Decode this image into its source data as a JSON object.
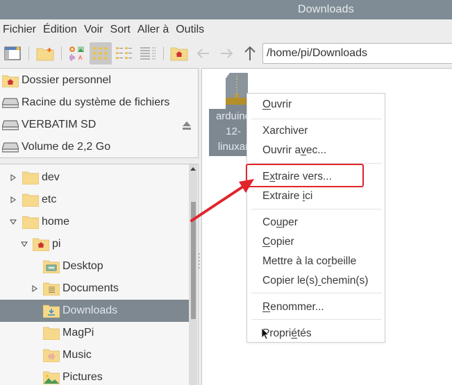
{
  "window": {
    "title": "Downloads"
  },
  "menubar": {
    "items": [
      "Fichier",
      "Édition",
      "Voir",
      "Sort",
      "Aller à",
      "Outils"
    ]
  },
  "toolbar": {
    "buttons": [
      {
        "icon": "new-window-icon"
      },
      {
        "icon": "new-folder-icon"
      },
      {
        "icon": "thumbnail-view-icon"
      },
      {
        "icon": "icon-view-icon",
        "active": true
      },
      {
        "icon": "compact-view-icon"
      },
      {
        "icon": "detailed-list-view-icon"
      },
      {
        "icon": "home-folder-icon"
      },
      {
        "icon": "back-arrow-icon",
        "enabled": false
      },
      {
        "icon": "forward-arrow-icon",
        "enabled": false
      },
      {
        "icon": "up-arrow-icon",
        "enabled": true
      }
    ],
    "path": "/home/pi/Downloads"
  },
  "places": [
    {
      "label": "Dossier personnel",
      "icon": "home-folder-icon"
    },
    {
      "label": "Racine du système de fichiers",
      "icon": "drive-icon"
    },
    {
      "label": "VERBATIM SD",
      "icon": "drive-icon",
      "eject": true
    },
    {
      "label": "Volume de 2,2 Go",
      "icon": "drive-icon"
    }
  ],
  "tree": [
    {
      "label": "dev",
      "depth": 0,
      "expander": "collapsed",
      "icon": "folder-icon"
    },
    {
      "label": "etc",
      "depth": 0,
      "expander": "collapsed",
      "icon": "folder-icon"
    },
    {
      "label": "home",
      "depth": 0,
      "expander": "expanded",
      "icon": "folder-icon"
    },
    {
      "label": "pi",
      "depth": 1,
      "expander": "expanded",
      "icon": "home-folder-icon"
    },
    {
      "label": "Desktop",
      "depth": 2,
      "expander": "none",
      "icon": "desktop-folder-icon"
    },
    {
      "label": "Documents",
      "depth": 2,
      "expander": "collapsed",
      "icon": "documents-folder-icon"
    },
    {
      "label": "Downloads",
      "depth": 2,
      "expander": "none",
      "icon": "downloads-folder-icon",
      "selected": true
    },
    {
      "label": "MagPi",
      "depth": 2,
      "expander": "none",
      "icon": "folder-icon"
    },
    {
      "label": "Music",
      "depth": 2,
      "expander": "none",
      "icon": "music-folder-icon"
    },
    {
      "label": "Pictures",
      "depth": 2,
      "expander": "none",
      "icon": "pictures-folder-icon"
    }
  ],
  "files": [
    {
      "name_lines": [
        "arduino",
        "12-",
        "linuxar"
      ],
      "icon": "archive-icon",
      "selected": true
    }
  ],
  "context_menu": {
    "items": [
      {
        "label": "Ouvrir",
        "mnemonic_index": 0
      },
      {
        "separator": true
      },
      {
        "label": "Xarchiver",
        "mnemonic_index": -1
      },
      {
        "label": "Ouvrir avec...",
        "mnemonic_index": 8
      },
      {
        "separator": true
      },
      {
        "label": "Extraire vers...",
        "mnemonic_index": 1,
        "highlighted": true
      },
      {
        "label": "Extraire ici",
        "mnemonic_index": 9
      },
      {
        "separator": true
      },
      {
        "label": "Couper",
        "mnemonic_index": 2
      },
      {
        "label": "Copier",
        "mnemonic_index": 0
      },
      {
        "label": "Mettre à la corbeille",
        "mnemonic_index": 14
      },
      {
        "label": "Copier le(s) chemin(s)",
        "mnemonic_index": 12
      },
      {
        "separator": true
      },
      {
        "label": "Renommer...",
        "mnemonic_index": 0
      },
      {
        "separator": true
      },
      {
        "label": "Propriétés",
        "mnemonic_index": 6
      }
    ]
  },
  "annotation": {
    "color": "#e0242b",
    "target": "Extraire vers..."
  },
  "colors": {
    "titlebar": "#7f8c95",
    "selection": "#7d8891",
    "folder": "#f6d98b",
    "home_icon": "#cc3333"
  }
}
